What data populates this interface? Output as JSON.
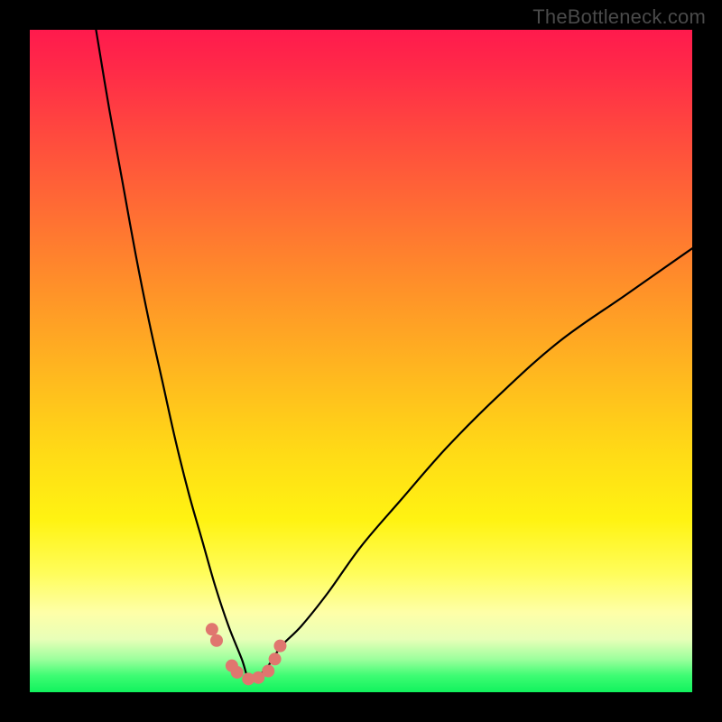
{
  "attribution": "TheBottleneck.com",
  "chart_data": {
    "type": "line",
    "title": "",
    "xlabel": "",
    "ylabel": "",
    "xlim": [
      0,
      100
    ],
    "ylim": [
      0,
      100
    ],
    "notes": "Single V-shaped bottleneck curve over a vertical red-to-green gradient. Vertex near x≈33, y≈2. Left branch reaches y=100 at x≈10; right branch reaches y≈67 at x=100.",
    "series": [
      {
        "name": "bottleneck-curve",
        "x": [
          10,
          12,
          14,
          16,
          18,
          20,
          22,
          24,
          26,
          28,
          30,
          32,
          33,
          34,
          36,
          38,
          41,
          45,
          50,
          56,
          63,
          71,
          80,
          90,
          100
        ],
        "y": [
          100,
          88,
          77,
          66,
          56,
          47,
          38,
          30,
          23,
          16,
          10,
          5,
          2,
          2,
          4,
          7,
          10,
          15,
          22,
          29,
          37,
          45,
          53,
          60,
          67
        ]
      }
    ],
    "markers": {
      "name": "vertex-dots",
      "color": "#e0766f",
      "x": [
        27.5,
        28.2,
        30.5,
        31.3,
        33.0,
        34.5,
        36.0,
        37.0,
        37.8
      ],
      "y": [
        9.5,
        7.8,
        4.0,
        3.0,
        2.0,
        2.2,
        3.2,
        5.0,
        7.0
      ]
    }
  }
}
